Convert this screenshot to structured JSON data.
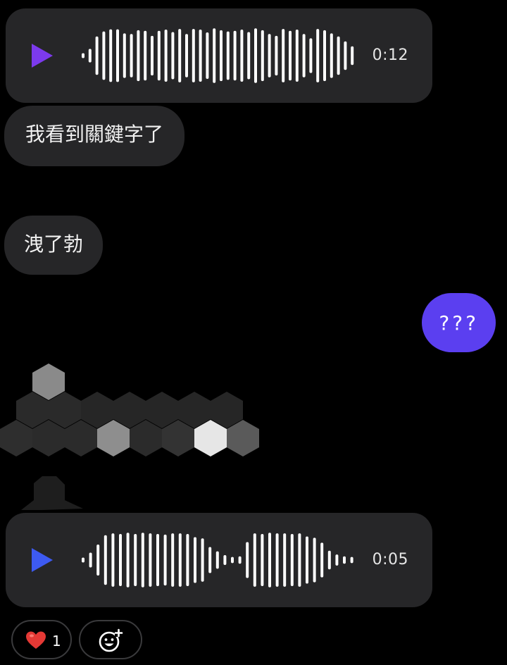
{
  "colors": {
    "incoming_bubble": "#262628",
    "outgoing_bubble": "#5b3ff0",
    "play_top": "#7c3aed",
    "play_bottom": "#3d5af1",
    "wave": "#ffffff"
  },
  "voice_messages": [
    {
      "duration": "0:12",
      "play_icon": "play-icon",
      "bars": [
        0.08,
        0.22,
        0.62,
        0.78,
        0.85,
        0.85,
        0.72,
        0.7,
        0.82,
        0.8,
        0.64,
        0.8,
        0.84,
        0.76,
        0.86,
        0.7,
        0.86,
        0.84,
        0.75,
        0.88,
        0.82,
        0.78,
        0.8,
        0.84,
        0.76,
        0.88,
        0.82,
        0.7,
        0.64,
        0.86,
        0.8,
        0.84,
        0.7,
        0.56,
        0.86,
        0.82,
        0.72,
        0.62,
        0.46,
        0.3
      ]
    },
    {
      "duration": "0:05",
      "play_icon": "play-icon",
      "bars": [
        0.08,
        0.24,
        0.5,
        0.8,
        0.86,
        0.84,
        0.88,
        0.84,
        0.88,
        0.86,
        0.84,
        0.82,
        0.86,
        0.86,
        0.84,
        0.74,
        0.7,
        0.42,
        0.28,
        0.16,
        0.1,
        0.12,
        0.58,
        0.86,
        0.84,
        0.88,
        0.86,
        0.86,
        0.84,
        0.86,
        0.76,
        0.72,
        0.56,
        0.3,
        0.18,
        0.12,
        0.1
      ]
    }
  ],
  "messages": {
    "incoming_keyword": "我看到關鍵字了",
    "incoming_yixie": "洩了勃",
    "outgoing": "???"
  },
  "sticker": {
    "icon": "hexagon-sticker",
    "tiles_note": "grey hexagon mosaic"
  },
  "reactions": {
    "heart_icon": "heart-icon",
    "heart_count": "1",
    "add_reaction_icon": "add-reaction-icon"
  }
}
